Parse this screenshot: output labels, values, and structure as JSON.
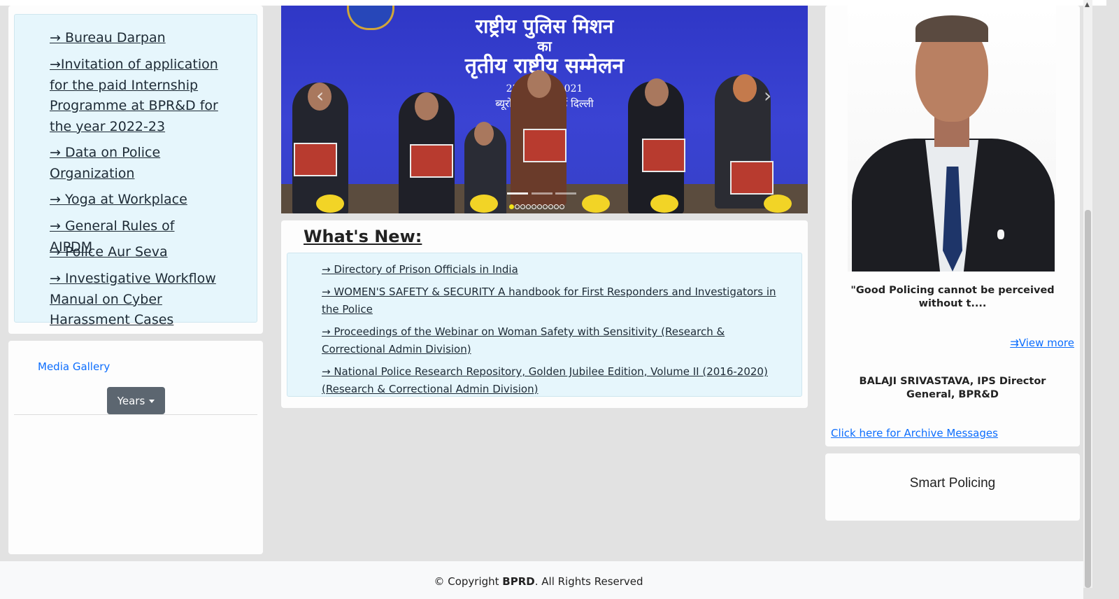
{
  "left_links": {
    "items": [
      {
        "label": "→ Bureau Darpan"
      },
      {
        "label": "→Invitation of application for the paid Internship Programme at BPR&D for the year 2022-23"
      },
      {
        "label": "→ Data on Police Organization"
      },
      {
        "label": "→ Yoga at Workplace"
      },
      {
        "label": "→ General Rules of AIPDM"
      },
      {
        "label": "→ Police Aur Seva"
      },
      {
        "label": "→ Investigative Workflow Manual on Cyber Harassment Cases"
      }
    ]
  },
  "media": {
    "gallery_label": "Media Gallery",
    "years_button": "Years"
  },
  "carousel": {
    "hindi_line1": "राष्ट्रीय पुलिस मिशन",
    "hindi_line2": "का",
    "hindi_line3": "तृतीय राष्ट्रीय सम्मेलन",
    "hindi_line4": "23 - नवम्बर, 2021",
    "hindi_line5": "ब्यूरो मुख्यालय, नई दिल्ली",
    "prev_icon": "‹",
    "next_icon": "›",
    "slide_count": 10,
    "active_slide": 0
  },
  "whats_new": {
    "title": "What's New:",
    "items": [
      {
        "label": "→ Directory of Prison Officials in India"
      },
      {
        "label": "→ WOMEN'S SAFETY & SECURITY A handbook for First Responders and Investigators in the Police"
      },
      {
        "label": "→ Proceedings of the Webinar on Woman Safety with Sensitivity (Research & Correctional Admin Division)"
      },
      {
        "label": "→ National Police Research Repository, Golden Jubilee Edition, Volume II (2016-2020) (Research & Correctional Admin Division)"
      }
    ]
  },
  "director": {
    "quote": "\"Good Policing cannot be perceived without t....",
    "view_more": "⇉View more",
    "name": "BALAJI SRIVASTAVA, IPS Director General, BPR&D",
    "archive_link": "Click here for Archive Messages"
  },
  "smart_policing": {
    "title": "Smart Policing"
  },
  "footer": {
    "prefix": "© Copyright ",
    "brand": "BPRD",
    "suffix": ". All Rights Reserved"
  },
  "colors": {
    "link_blue": "#0d6efd",
    "info_box_bg": "#e6f6fc",
    "button_gray": "#5c6670",
    "page_bg": "#e2e2e2"
  }
}
